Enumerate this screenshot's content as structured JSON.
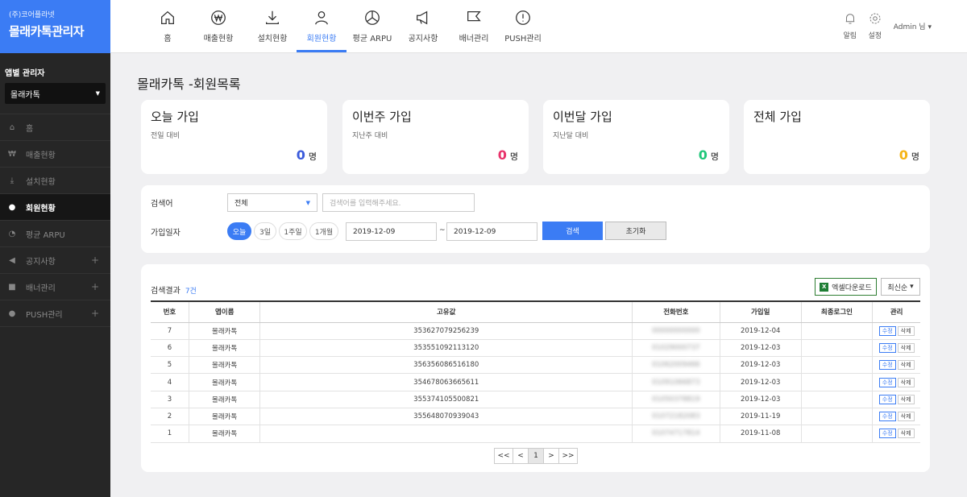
{
  "brand": {
    "subtitle": "(주)코어플라넷",
    "title": "몰래카톡관리자"
  },
  "sidebar": {
    "app_label": "앱별 관리자",
    "app_selected": "몰래카톡",
    "items": [
      {
        "label": "홈",
        "icon": "home-icon"
      },
      {
        "label": "매출현황",
        "icon": "won-icon"
      },
      {
        "label": "설치현황",
        "icon": "download-icon"
      },
      {
        "label": "회원현황",
        "icon": "user-icon"
      },
      {
        "label": "평균 ARPU",
        "icon": "pie-icon"
      },
      {
        "label": "공지사항",
        "icon": "megaphone-icon",
        "plus": "+"
      },
      {
        "label": "배너관리",
        "icon": "flag-icon",
        "plus": "+"
      },
      {
        "label": "PUSH관리",
        "icon": "alert-icon",
        "plus": "+"
      }
    ]
  },
  "topnav": [
    {
      "label": "홈"
    },
    {
      "label": "매출현황"
    },
    {
      "label": "설치현황"
    },
    {
      "label": "회원현황"
    },
    {
      "label": "평균 ARPU"
    },
    {
      "label": "공지사항"
    },
    {
      "label": "배너관리"
    },
    {
      "label": "PUSH관리"
    }
  ],
  "tools": {
    "alarm": "알림",
    "settings": "설정",
    "admin": "Admin 님"
  },
  "page": {
    "title": "몰래카톡 -회원목록"
  },
  "cards": [
    {
      "title": "오늘 가입",
      "sub": "전일 대비",
      "value": "0",
      "unit": "명",
      "color": "#3b5bdb"
    },
    {
      "title": "이번주 가입",
      "sub": "지난주 대비",
      "value": "0",
      "unit": "명",
      "color": "#e8336b"
    },
    {
      "title": "이번달 가입",
      "sub": "지난달 대비",
      "value": "0",
      "unit": "명",
      "color": "#20c77a"
    },
    {
      "title": "전체 가입",
      "sub": "",
      "value": "0",
      "unit": "명",
      "color": "#f5b416"
    }
  ],
  "search": {
    "keyword_label": "검색어",
    "select_value": "전체",
    "input_placeholder": "검색어를 입력해주세요.",
    "date_label": "가입일자",
    "pills": [
      "오늘",
      "3일",
      "1주일",
      "1개월"
    ],
    "date_from": "2019-12-09",
    "tilde": "~",
    "date_to": "2019-12-09",
    "search_button": "검색",
    "reset_button": "초기화"
  },
  "results": {
    "title": "검색결과",
    "count": "7건",
    "excel_button": "엑셀다운로드",
    "excel_icon_text": "X",
    "sort_button": "최신순",
    "columns": [
      "번호",
      "앱이름",
      "고유값",
      "전화번호",
      "가입일",
      "최종로그인",
      "관리"
    ],
    "edit_label": "수정",
    "delete_label": "삭제",
    "rows": [
      {
        "no": "7",
        "app": "몰래카톡",
        "uid": "353627079256239",
        "phone": "00000000000",
        "joined": "2019-12-04",
        "last": ""
      },
      {
        "no": "6",
        "app": "몰래카톡",
        "uid": "353551092113120",
        "phone": "01029000737",
        "joined": "2019-12-03",
        "last": ""
      },
      {
        "no": "5",
        "app": "몰래카톡",
        "uid": "356356086516180",
        "phone": "01062009466",
        "joined": "2019-12-03",
        "last": ""
      },
      {
        "no": "4",
        "app": "몰래카톡",
        "uid": "354678063665611",
        "phone": "01091066873",
        "joined": "2019-12-03",
        "last": ""
      },
      {
        "no": "3",
        "app": "몰래카톡",
        "uid": "355374105500821",
        "phone": "01050378819",
        "joined": "2019-12-03",
        "last": ""
      },
      {
        "no": "2",
        "app": "몰래카톡",
        "uid": "355648070939043",
        "phone": "01072182083",
        "joined": "2019-11-19",
        "last": ""
      },
      {
        "no": "1",
        "app": "몰래카톡",
        "uid": "",
        "phone": "01074717814",
        "joined": "2019-11-08",
        "last": ""
      }
    ],
    "pager": {
      "first": "<<",
      "prev": "<",
      "page": "1",
      "next": ">",
      "last": ">>"
    }
  }
}
